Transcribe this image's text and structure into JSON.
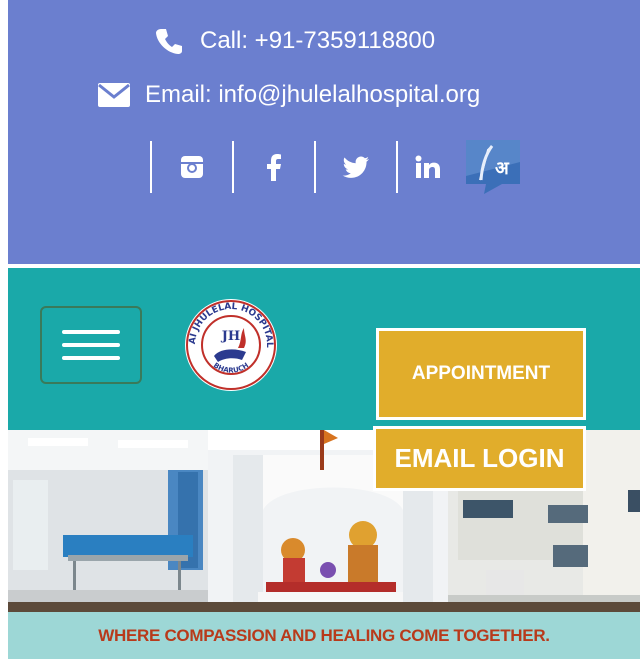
{
  "topbar": {
    "call": "Call: +91-7359118800",
    "email": "Email: info@jhulelalhospital.org",
    "social": [
      {
        "name": "instagram-icon",
        "glyph": "instagram"
      },
      {
        "name": "facebook-icon",
        "glyph": "f"
      },
      {
        "name": "twitter-icon",
        "glyph": "twitter"
      },
      {
        "name": "linkedin-icon",
        "glyph": "in"
      },
      {
        "name": "language-translate-icon",
        "glyph": "अ"
      }
    ]
  },
  "nav": {
    "logo_text_top": "JAI JHULELAL HOSPITAL",
    "logo_text_bottom": "BHARUCH",
    "logo_monogram": "JH",
    "appointment_label": "APPOINTMENT",
    "email_login_label": "EMAIL LOGIN"
  },
  "hero": {
    "tagline": "WHERE COMPASSION AND HEALING COME TOGETHER."
  },
  "colors": {
    "topbar": "#6b7fcf",
    "navbar": "#1aa9a9",
    "button": "#e1ad2b",
    "tagline": "#b83a1b"
  }
}
